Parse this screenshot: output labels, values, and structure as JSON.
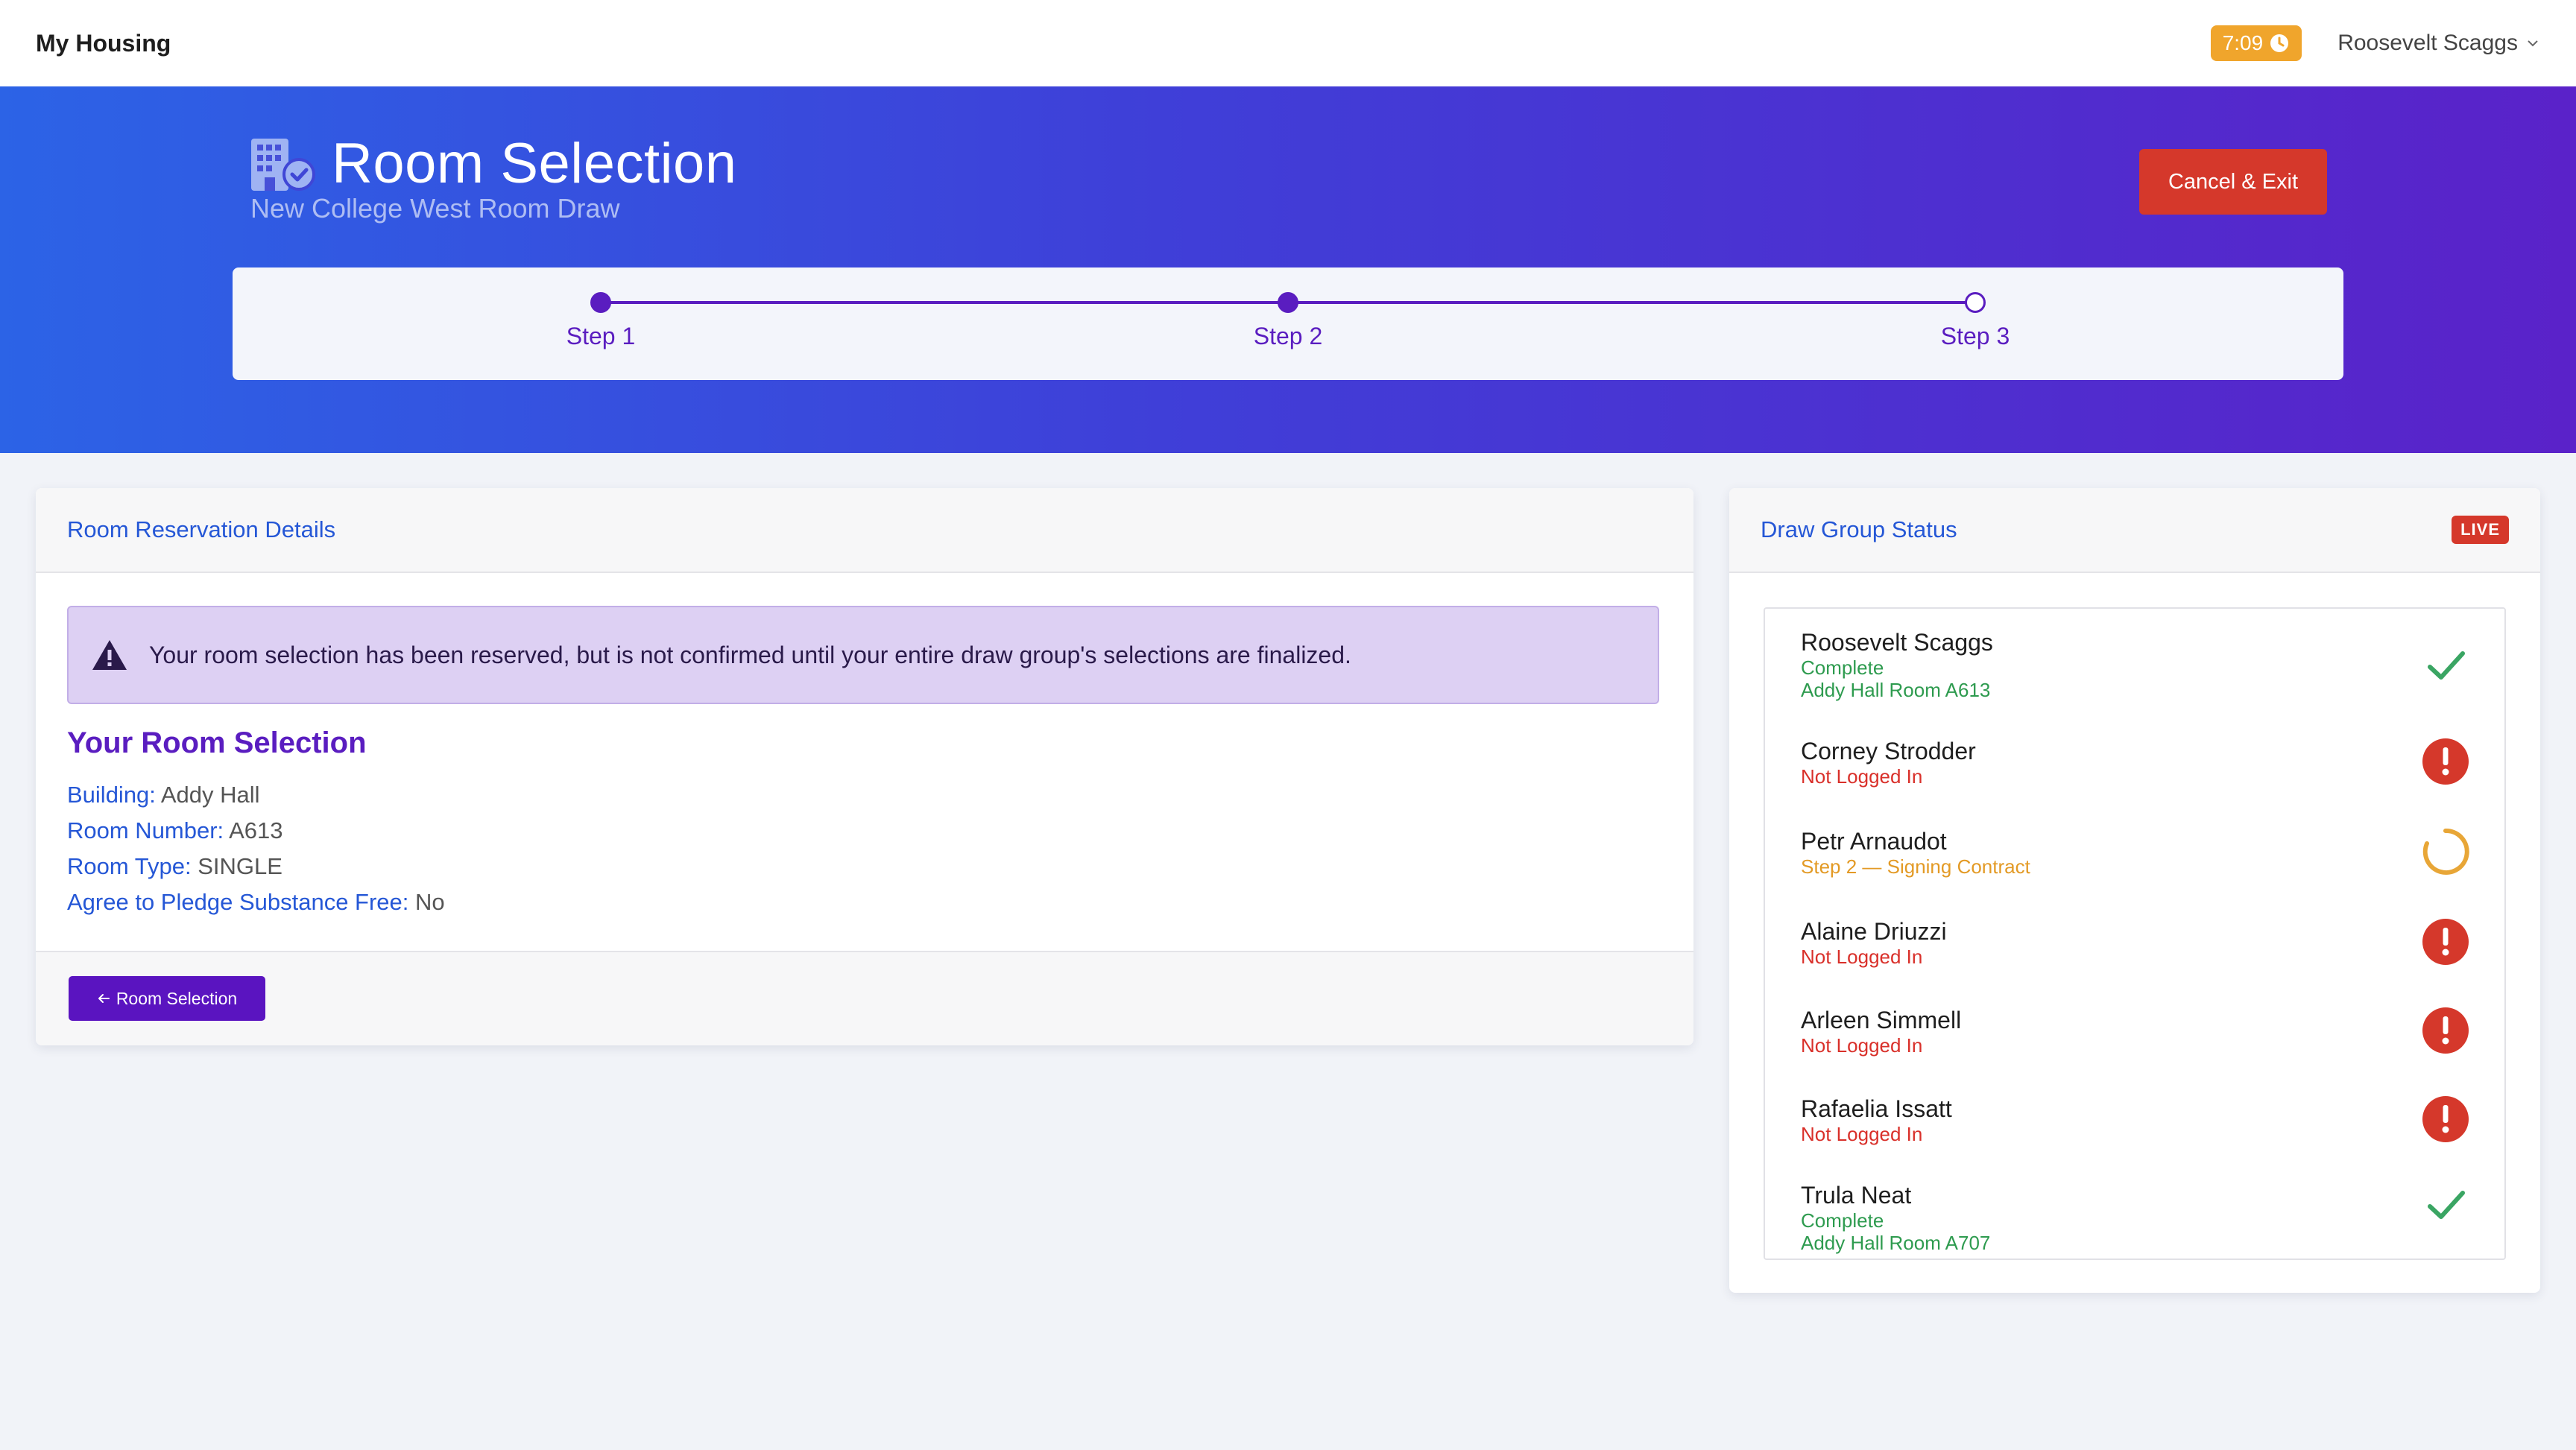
{
  "navbar": {
    "brand": "My Housing",
    "timer": "7:09",
    "timer_icon": "clock-icon",
    "user_name": "Roosevelt Scaggs"
  },
  "hero": {
    "title": "Room Selection",
    "subtitle": "New College West Room Draw",
    "cancel_label": "Cancel & Exit",
    "steps": [
      {
        "label": "Step 1",
        "state": "complete"
      },
      {
        "label": "Step 2",
        "state": "complete"
      },
      {
        "label": "Step 3",
        "state": "current"
      }
    ]
  },
  "reservation": {
    "card_title": "Room Reservation Details",
    "alert_text": "Your room selection has been reserved, but is not confirmed until your entire draw group's selections are finalized.",
    "heading": "Your Room Selection",
    "details": [
      {
        "key": "Building:",
        "value": "Addy Hall"
      },
      {
        "key": "Room Number:",
        "value": "A613"
      },
      {
        "key": "Room Type:",
        "value": "SINGLE"
      },
      {
        "key": "Agree to Pledge Substance Free:",
        "value": "No"
      }
    ],
    "back_label": "Room Selection"
  },
  "group": {
    "card_title": "Draw Group Status",
    "live_label": "LIVE",
    "members": [
      {
        "name": "Roosevelt Scaggs",
        "status": "Complete",
        "detail": "Addy Hall Room A613",
        "state": "complete"
      },
      {
        "name": "Corney Strodder",
        "status": "Not Logged In",
        "detail": "",
        "state": "warn"
      },
      {
        "name": "Petr Arnaudot",
        "status": "Step 2 — Signing Contract",
        "detail": "",
        "state": "progress"
      },
      {
        "name": "Alaine Driuzzi",
        "status": "Not Logged In",
        "detail": "",
        "state": "warn"
      },
      {
        "name": "Arleen Simmell",
        "status": "Not Logged In",
        "detail": "",
        "state": "warn"
      },
      {
        "name": "Rafaelia Issatt",
        "status": "Not Logged In",
        "detail": "",
        "state": "warn"
      },
      {
        "name": "Trula Neat",
        "status": "Complete",
        "detail": "Addy Hall Room A707",
        "state": "complete"
      }
    ]
  },
  "colors": {
    "accent_purple": "#5a1dc0",
    "link_blue": "#2557d6",
    "danger": "#d5382b",
    "success": "#2e9b4f",
    "warning": "#e39a25"
  }
}
